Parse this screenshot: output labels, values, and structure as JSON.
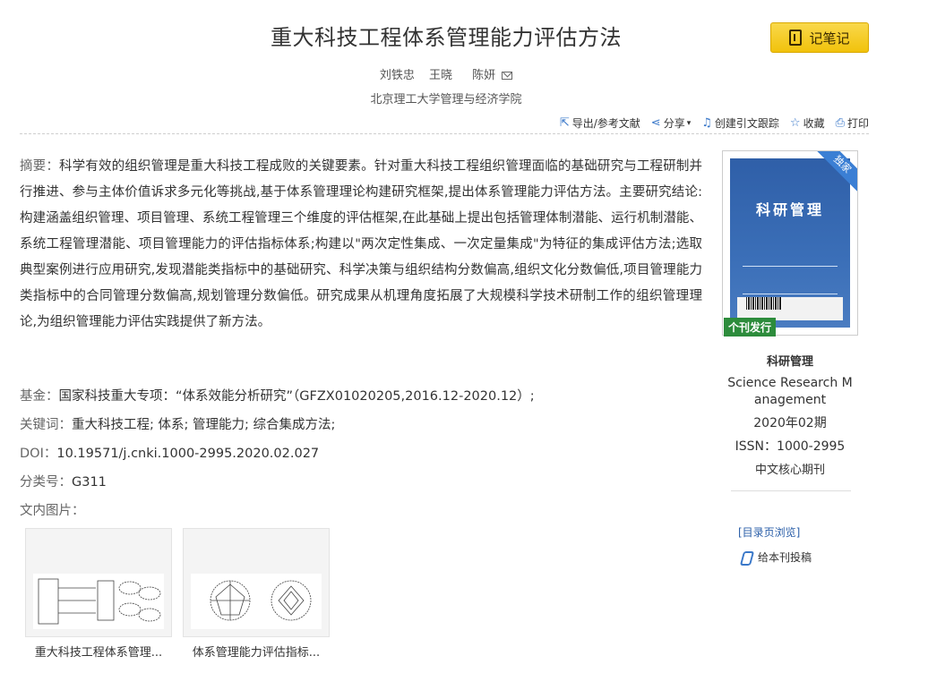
{
  "title": "重大科技工程体系管理能力评估方法",
  "note_button": "记笔记",
  "authors": [
    "刘铁忠",
    "王晓",
    "陈妍"
  ],
  "affiliation": "北京理工大学管理与经济学院",
  "toolbar": {
    "export": "导出/参考文献",
    "share": "分享",
    "track": "创建引文跟踪",
    "favorite": "收藏",
    "print": "打印"
  },
  "abstract": {
    "label": "摘要：",
    "text": "科学有效的组织管理是重大科技工程成败的关键要素。针对重大科技工程组织管理面临的基础研究与工程研制并行推进、参与主体价值诉求多元化等挑战,基于体系管理理论构建研究框架,提出体系管理能力评估方法。主要研究结论:构建涵盖组织管理、项目管理、系统工程管理三个维度的评估框架,在此基础上提出包括管理体制潜能、运行机制潜能、系统工程管理潜能、项目管理能力的评估指标体系;构建以\"两次定性集成、一次定量集成\"为特征的集成评估方法;选取典型案例进行应用研究,发现潜能类指标中的基础研究、科学决策与组织结构分数偏高,组织文化分数偏低,项目管理能力类指标中的合同管理分数偏高,规划管理分数偏低。研究成果从机理角度拓展了大规模科学技术研制工作的组织管理理论,为组织管理能力评估实践提供了新方法。"
  },
  "fund": {
    "label": "基金：",
    "value": "国家科技重大专项：“体系效能分析研究”（GFZX01020205,2016.12-2020.12）;"
  },
  "keywords": {
    "label": "关键词：",
    "value": "重大科技工程; 体系; 管理能力; 综合集成方法;"
  },
  "doi": {
    "label": "DOI：",
    "value": "10.19571/j.cnki.1000-2995.2020.02.027"
  },
  "classification": {
    "label": "分类号：",
    "value": "G311"
  },
  "figures": {
    "label": "文内图片：",
    "items": [
      {
        "caption": "重大科技工程体系管理..."
      },
      {
        "caption": "体系管理能力评估指标..."
      }
    ]
  },
  "journal": {
    "cover_title": "科研管理",
    "exclusive": "独家",
    "tag": "个刊发行",
    "name": "科研管理",
    "english": "Science Research M anagement",
    "issue": "2020年02期",
    "issn": "ISSN：1000-2995",
    "core": "中文核心期刊"
  },
  "links": {
    "toc": "[目录页浏览]",
    "submit": "给本刊投稿"
  }
}
